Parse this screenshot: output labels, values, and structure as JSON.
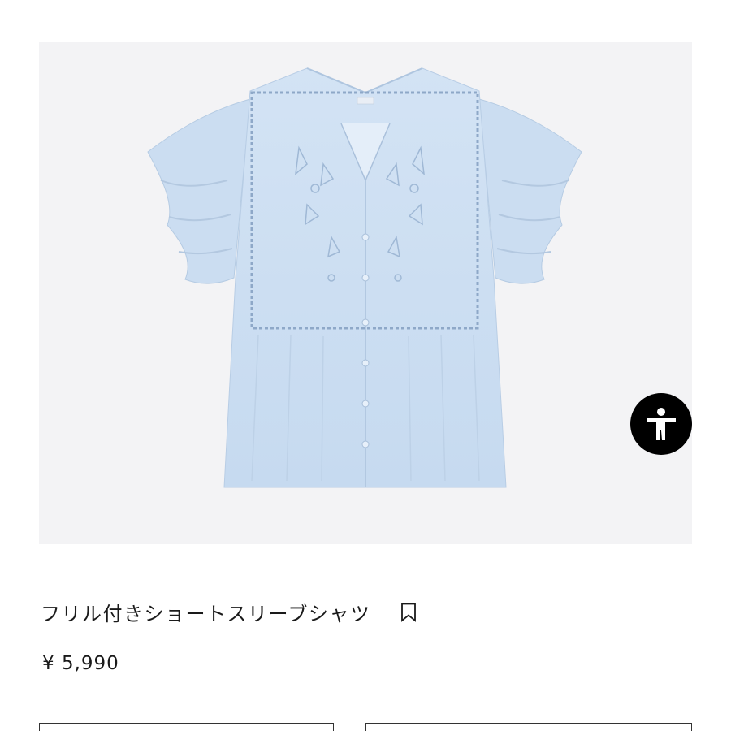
{
  "product": {
    "image_alt": "light blue ruffle short sleeve shirt",
    "title": "フリル付きショートスリーブシャツ",
    "price": "¥ 5,990"
  },
  "icons": {
    "bookmark": "bookmark-icon",
    "accessibility": "accessibility-icon"
  },
  "colors": {
    "shirt": "#cfe0f2",
    "image_background": "#f3f3f5",
    "accessibility_button": "#000000"
  }
}
